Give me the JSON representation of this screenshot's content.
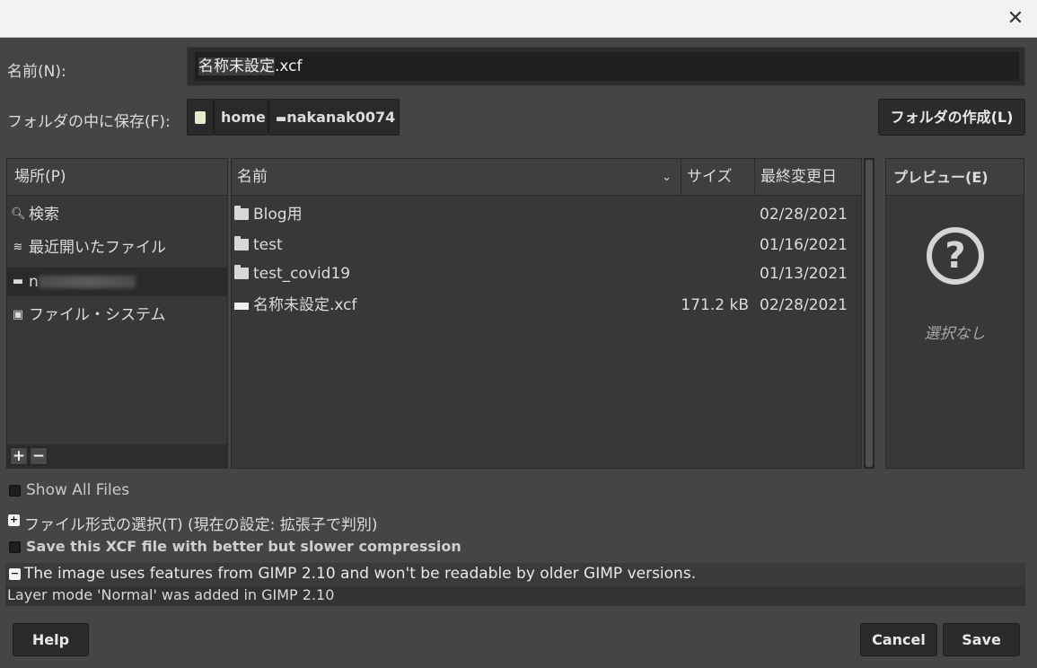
{
  "titlebar": {
    "close_glyph": "✕"
  },
  "name_field": {
    "label": "名前(N):",
    "value_selected": "名称未設定",
    "value_ext": ".xcf"
  },
  "folder": {
    "label": "フォルダの中に保存(F):",
    "crumbs": [
      {
        "icon": "drive-icon",
        "label": ""
      },
      {
        "icon": "",
        "label": "home"
      },
      {
        "icon": "folder-icon",
        "label": "nakanak0074"
      }
    ],
    "create_folder_button": "フォルダの作成(L)"
  },
  "places": {
    "header": "場所(P)",
    "items": [
      {
        "icon": "search-icon",
        "label": "検索"
      },
      {
        "icon": "recent-icon",
        "label": "最近開いたファイル"
      },
      {
        "icon": "folder-icon",
        "label": "n"
      },
      {
        "icon": "drive-icon",
        "label": "ファイル・システム"
      }
    ],
    "add_glyph": "+",
    "remove_glyph": "−"
  },
  "files": {
    "columns": {
      "name": "名前",
      "size": "サイズ",
      "modified": "最終変更日"
    },
    "rows": [
      {
        "type": "folder",
        "name": "Blog用",
        "size": "",
        "modified": "02/28/2021"
      },
      {
        "type": "folder",
        "name": "test",
        "size": "",
        "modified": "01/16/2021"
      },
      {
        "type": "folder",
        "name": "test_covid19",
        "size": "",
        "modified": "01/13/2021"
      },
      {
        "type": "file",
        "name": "名称未設定.xcf",
        "size": "171.2 kB",
        "modified": "02/28/2021"
      }
    ]
  },
  "preview": {
    "header": "プレビュー(E)",
    "icon_glyph": "?",
    "empty_text": "選択なし"
  },
  "options": {
    "show_all_files": "Show All Files",
    "file_type": "ファイル形式の選択(T) (現在の設定: 拡張子で判別)",
    "compression": "Save this XCF file with better but slower compression",
    "compat_warning": "The image uses features from GIMP 2.10 and won't be readable by older GIMP versions.",
    "compat_detail": "Layer mode 'Normal' was added in GIMP 2.10"
  },
  "buttons": {
    "help": "Help",
    "cancel": "Cancel",
    "save": "Save"
  }
}
